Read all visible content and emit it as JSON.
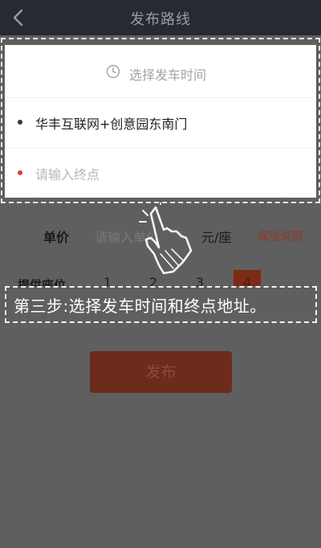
{
  "navbar": {
    "title": "发布路线"
  },
  "card": {
    "time_placeholder": "选择发车时间",
    "start_address": "华丰互联网+创意园东南门",
    "end_placeholder": "请输入终点"
  },
  "price": {
    "label": "单价",
    "placeholder": "请输入单位座价",
    "unit": "元/座",
    "insurance_link": "保险说明"
  },
  "seats": {
    "label": "提供座位",
    "options": [
      "1",
      "2",
      "3",
      "4"
    ],
    "selected": "4"
  },
  "guide": {
    "step_text": "第三步:选择发车时间和终点地址。"
  },
  "actions": {
    "publish_label": "发布"
  },
  "colors": {
    "navbar": "#262a33",
    "overlay": "#5f5f5f",
    "accent_dim": "#7d2b16",
    "start_dot": "#2f3447",
    "end_dot": "#e33b3b"
  }
}
